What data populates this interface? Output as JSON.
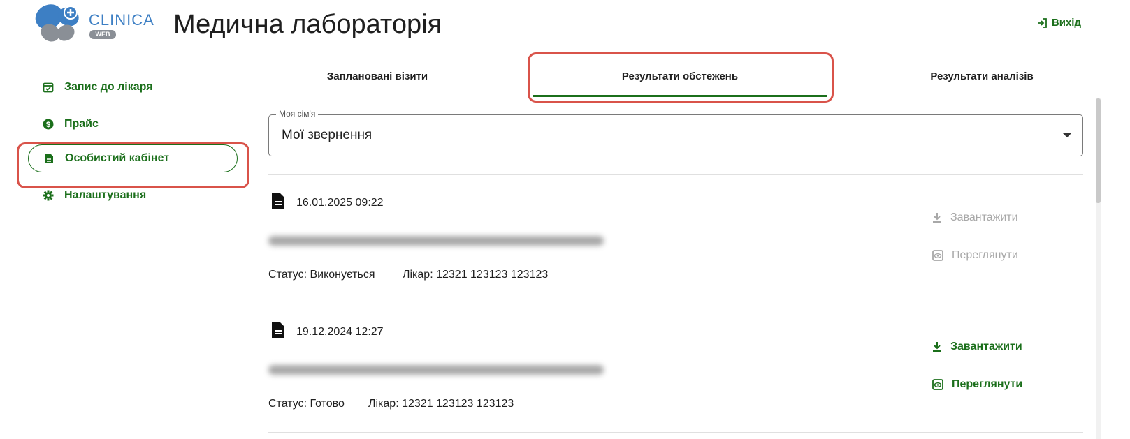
{
  "header": {
    "logo_word": "CLINICA",
    "logo_sub": "WEB",
    "title": "Медична лабораторія",
    "logout_label": "Вихід"
  },
  "colors": {
    "accent": "#1b6f1b",
    "highlight": "#d9534a",
    "logo_blue": "#3d7fc4",
    "logo_gray": "#8a8f96"
  },
  "sidebar": {
    "items": [
      {
        "label": "Запис до лікаря",
        "icon": "calendar-check-icon"
      },
      {
        "label": "Прайс",
        "icon": "dollar-circle-icon"
      },
      {
        "label": "Особистий кабінет",
        "icon": "document-icon",
        "active": true
      },
      {
        "label": "Налаштування",
        "icon": "gear-icon"
      }
    ]
  },
  "tabs": [
    {
      "label": "Заплановані візити"
    },
    {
      "label": "Результати обстежень",
      "active": true
    },
    {
      "label": "Результати аналізів"
    }
  ],
  "family_select": {
    "label": "Моя сім'я",
    "value": "Мої звернення"
  },
  "records": [
    {
      "date": "16.01.2025 09:22",
      "status": "Статус: Виконується",
      "doctor": "Лікар: 12321 123123 123123",
      "download_label": "Завантажити",
      "view_label": "Переглянути",
      "actions_enabled": false
    },
    {
      "date": "19.12.2024 12:27",
      "status": "Статус: Готово",
      "doctor": "Лікар: 12321 123123 123123",
      "download_label": "Завантажити",
      "view_label": "Переглянути",
      "actions_enabled": true
    }
  ]
}
